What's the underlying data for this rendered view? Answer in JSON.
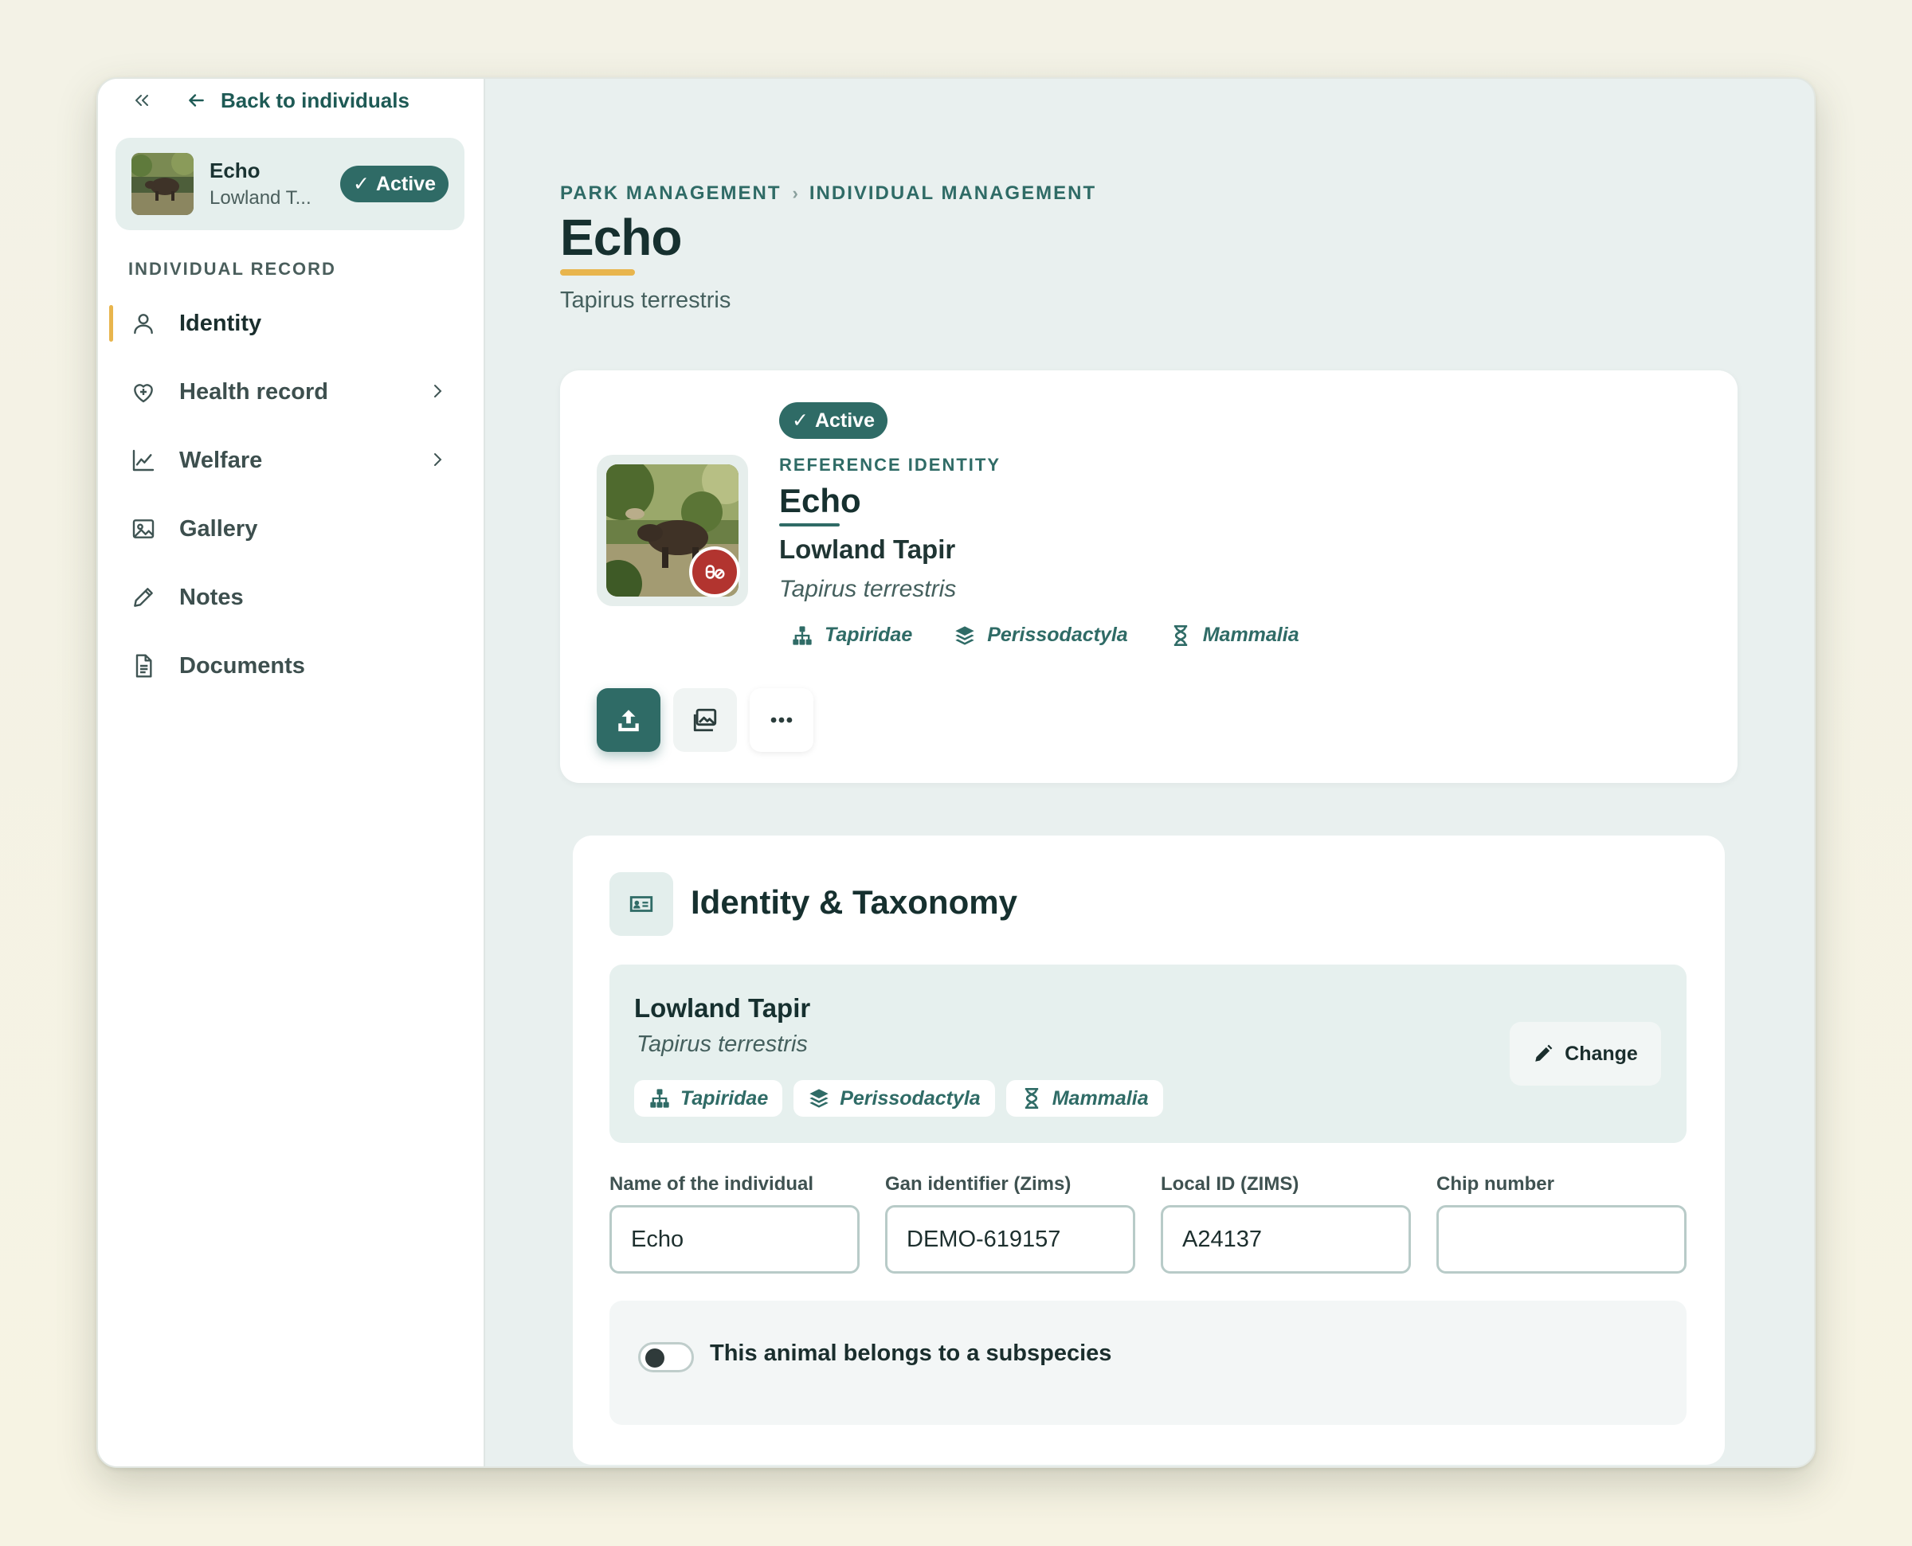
{
  "nav_top": {
    "back_label": "Back to individuals"
  },
  "individual": {
    "name": "Echo",
    "common_name": "Lowland Tapir",
    "common_name_truncated": "Lowland T...",
    "scientific_name": "Tapirus terrestris",
    "status": "Active"
  },
  "sidebar": {
    "section_label": "INDIVIDUAL RECORD",
    "items": [
      {
        "label": "Identity",
        "icon": "person-icon",
        "active": true
      },
      {
        "label": "Health record",
        "icon": "heart-plus-icon",
        "has_children": true
      },
      {
        "label": "Welfare",
        "icon": "line-chart-icon",
        "has_children": true
      },
      {
        "label": "Gallery",
        "icon": "image-icon"
      },
      {
        "label": "Notes",
        "icon": "pencil-icon"
      },
      {
        "label": "Documents",
        "icon": "document-icon"
      }
    ]
  },
  "breadcrumb": [
    "PARK MANAGEMENT",
    "INDIVIDUAL MANAGEMENT"
  ],
  "page": {
    "title": "Echo",
    "subtitle": "Tapirus terrestris"
  },
  "hero": {
    "status": "Active",
    "ref_label": "REFERENCE IDENTITY",
    "name": "Echo",
    "common_name": "Lowland Tapir",
    "scientific_name": "Tapirus terrestris",
    "taxa": [
      {
        "label": "Tapiridae",
        "icon": "hierarchy-icon"
      },
      {
        "label": "Perissodactyla",
        "icon": "layers-icon"
      },
      {
        "label": "Mammalia",
        "icon": "hourglass-icon"
      }
    ]
  },
  "identity_card": {
    "title": "Identity & Taxonomy",
    "species_common": "Lowland Tapir",
    "species_scientific": "Tapirus terrestris",
    "change_label": "Change",
    "fields": [
      {
        "label": "Name of the individual",
        "value": "Echo"
      },
      {
        "label": "Gan identifier (Zims)",
        "value": "DEMO-619157"
      },
      {
        "label": "Local ID (ZIMS)",
        "value": "A24137"
      },
      {
        "label": "Chip number",
        "value": ""
      }
    ],
    "subspecies_label": "This animal belongs to a subspecies",
    "subspecies_enabled": false
  },
  "colors": {
    "accent": "#2f6b66",
    "highlight": "#e8b54d",
    "alert": "#b2342f"
  }
}
